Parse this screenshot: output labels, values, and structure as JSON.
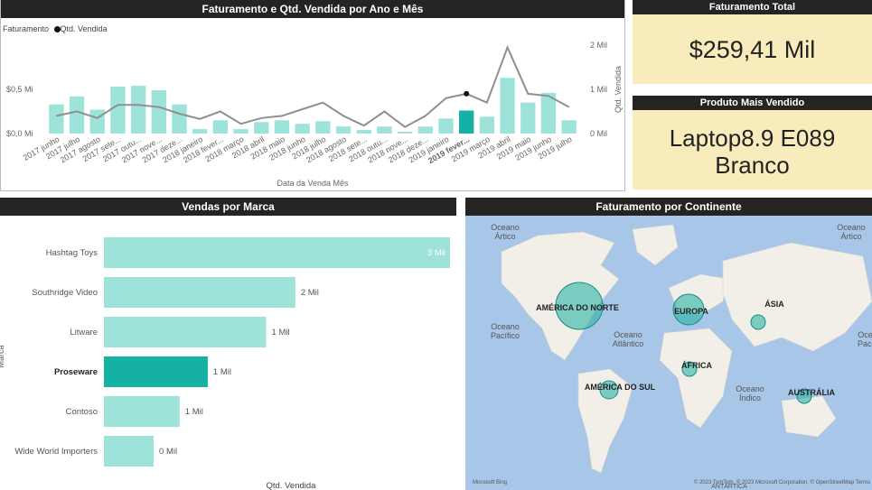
{
  "combo": {
    "title": "Faturamento e Qtd. Vendida por Ano e Mês",
    "legend_bar": "Faturamento",
    "legend_line": "Qtd. Vendida",
    "xlabel": "Data da Venda Mês",
    "ylabel_right": "Qtd. Vendida",
    "y_left_ticks": [
      "$0,5 Mi",
      "$0,0 Mi"
    ],
    "y_right_ticks": [
      "2 Mil",
      "1 Mil",
      "0 Mil"
    ]
  },
  "kpi_total": {
    "title": "Faturamento Total",
    "value": "$259,41 Mil"
  },
  "kpi_product": {
    "title": "Produto Mais Vendido",
    "value_line1": "Laptop8.9 E089",
    "value_line2": "Branco"
  },
  "brands": {
    "title": "Vendas por Marca",
    "xlabel": "Qtd. Vendida",
    "ylabel": "Marca"
  },
  "map": {
    "title": "Faturamento por Continente",
    "ocean_labels": [
      {
        "l1": "Oceano",
        "l2": "Ártico"
      },
      {
        "l1": "Oceano",
        "l2": "Ártico"
      },
      {
        "l1": "Oceano",
        "l2": "Pacífico"
      },
      {
        "l1": "Oceano",
        "l2": "Atlântico"
      },
      {
        "l1": "Oceano",
        "l2": "Pacífico"
      },
      {
        "l1": "Oceano",
        "l2": "Índico"
      }
    ],
    "continents": [
      "AMÉRICA DO NORTE",
      "EUROPA",
      "ÁSIA",
      "ÁFRICA",
      "AMÉRICA DO SUL",
      "AUSTRÁLIA"
    ],
    "footer_left": "Microsoft Bing",
    "footer_right": "© 2023 TomTom, © 2023 Microsoft Corporation, © OpenStreetMap  Terms",
    "antarctica": "ANTÁRTICA"
  },
  "chart_data": [
    {
      "type": "bar",
      "title": "Faturamento e Qtd. Vendida por Ano e Mês",
      "xlabel": "Data da Venda Mês",
      "ylabel": "Faturamento",
      "categories": [
        "2017 junho",
        "2017 julho",
        "2017 agosto",
        "2017 sete...",
        "2017 outu...",
        "2017 nove...",
        "2017 deze...",
        "2018 janeiro",
        "2018 fever...",
        "2018 março",
        "2018 abril",
        "2018 maio",
        "2018 junho",
        "2018 julho",
        "2018 agosto",
        "2018 sete...",
        "2018 outu...",
        "2018 nove...",
        "2018 deze...",
        "2019 janeiro",
        "2019 fever...",
        "2019 março",
        "2019 abril",
        "2019 maio",
        "2019 junho",
        "2019 julho"
      ],
      "series": [
        {
          "name": "Faturamento",
          "axis": "left",
          "values": [
            0.33,
            0.42,
            0.27,
            0.53,
            0.54,
            0.49,
            0.33,
            0.05,
            0.15,
            0.05,
            0.13,
            0.15,
            0.11,
            0.14,
            0.08,
            0.04,
            0.08,
            0.02,
            0.08,
            0.17,
            0.26,
            0.19,
            0.63,
            0.35,
            0.46,
            0.15
          ]
        },
        {
          "name": "Qtd. Vendida",
          "axis": "right",
          "values": [
            400,
            500,
            350,
            650,
            650,
            600,
            450,
            330,
            500,
            220,
            350,
            400,
            550,
            700,
            400,
            180,
            500,
            150,
            400,
            800,
            900,
            700,
            1950,
            900,
            850,
            600
          ]
        }
      ],
      "y_left_range": [
        0,
        1.0
      ],
      "y_right_range": [
        0,
        2000
      ],
      "highlight": "2019 fever..."
    },
    {
      "type": "bar",
      "title": "Vendas por Marca",
      "orientation": "horizontal",
      "xlabel": "Qtd. Vendida",
      "ylabel": "Marca",
      "categories": [
        "Hashtag Toys",
        "Southridge Video",
        "Litware",
        "Proseware",
        "Contoso",
        "Wide World Importers"
      ],
      "values": [
        3,
        2,
        1,
        1,
        1,
        0
      ],
      "data_labels": [
        "3 Mil",
        "2 Mil",
        "1 Mil",
        "1 Mil",
        "1 Mil",
        "0 Mil"
      ],
      "approx_values": [
        3200,
        1770,
        1500,
        960,
        700,
        460
      ],
      "highlight": "Proseware"
    }
  ],
  "colors": {
    "bar": "#9ee3d9",
    "bar_highlight": "#15b1a5",
    "line": "#8f8f8f",
    "header": "#252423",
    "kpi_bg": "#f8ecbc",
    "ocean": "#a8c7e8",
    "land": "#f2efe9",
    "bubble": "#2ab3a5"
  }
}
